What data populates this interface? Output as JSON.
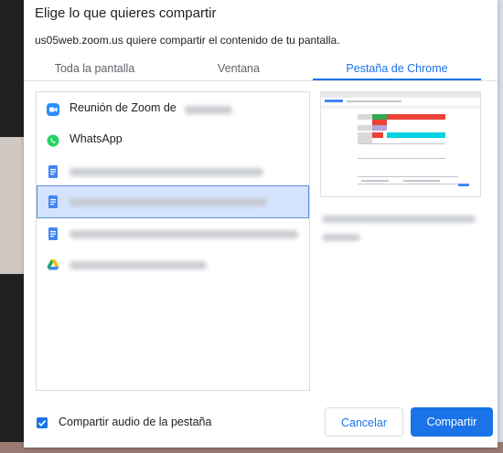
{
  "dialog": {
    "title": "Elige lo que quieres compartir",
    "subtitle": "us05web.zoom.us quiere compartir el contenido de tu pantalla."
  },
  "tabs": [
    {
      "label": "Toda la pantalla"
    },
    {
      "label": "Ventana"
    },
    {
      "label": "Pestaña de Chrome",
      "active": true
    }
  ],
  "list": {
    "items": [
      {
        "label": "Reunión de Zoom de",
        "icon": "zoom-icon",
        "selected": false
      },
      {
        "label": "WhatsApp",
        "icon": "whatsapp-icon",
        "selected": false
      },
      {
        "label": "",
        "icon": "google-docs-icon",
        "selected": false
      },
      {
        "label": "",
        "icon": "google-docs-icon",
        "selected": true
      },
      {
        "label": "",
        "icon": "google-docs-icon",
        "selected": false
      },
      {
        "label": "",
        "icon": "google-drive-icon",
        "selected": false
      }
    ]
  },
  "footer": {
    "audio_checkbox_label": "Compartir audio de la pestaña",
    "audio_checked": true,
    "cancel_label": "Cancelar",
    "share_label": "Compartir"
  },
  "colors": {
    "accent": "#1a73e8",
    "selected_row": "#d3e3fd"
  }
}
